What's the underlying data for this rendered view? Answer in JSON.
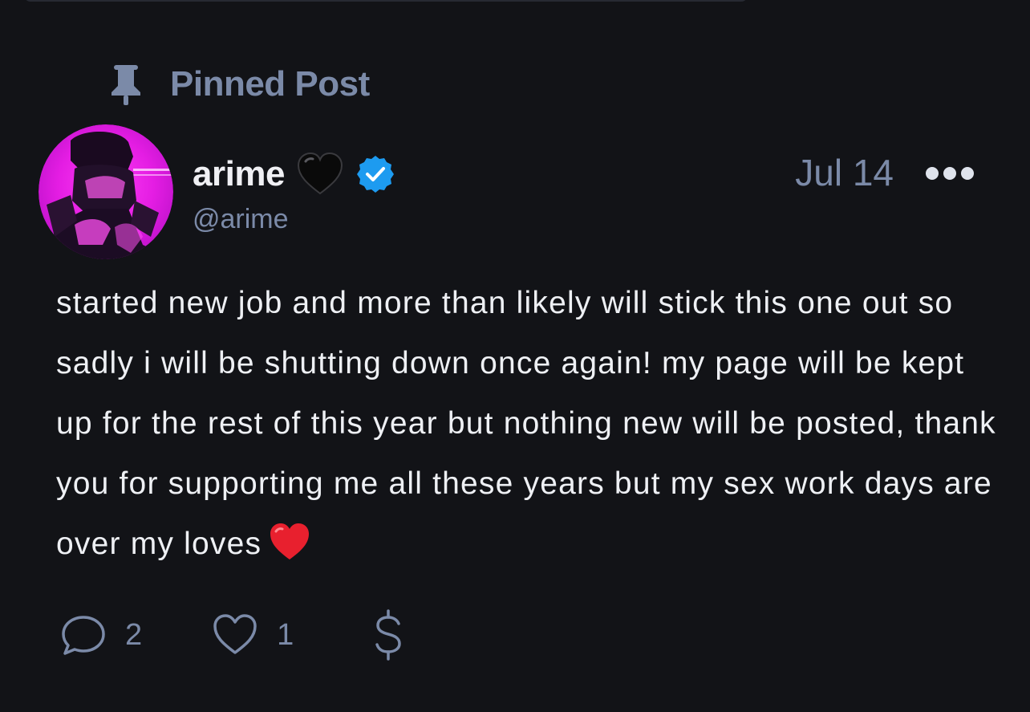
{
  "pinned": {
    "icon": "pin-icon",
    "label": "Pinned Post"
  },
  "author": {
    "display_name": "arime",
    "name_emoji": "black-heart-icon",
    "verified_icon": "verified-badge-icon",
    "handle": "@arime",
    "avatar": "avatar-photo"
  },
  "post": {
    "date": "Jul 14",
    "more_icon": "more-options-icon",
    "text": "started new job and more than likely will stick this one out so sadly i will be shutting down once again! my page will be kept up for the rest of this year but nothing new will be posted, thank you for supporting me all these years but my sex work days are over my loves",
    "text_emoji": "red-heart-icon"
  },
  "actions": {
    "comments": {
      "icon": "comment-icon",
      "count": "2"
    },
    "likes": {
      "icon": "heart-outline-icon",
      "count": "1"
    },
    "tip": {
      "icon": "dollar-icon"
    }
  },
  "colors": {
    "background": "#121317",
    "muted": "#7b8aa8",
    "text": "#eef0f4",
    "verified": "#1d9bf0",
    "red_heart": "#e8202e",
    "avatar_accent": "#e41de3"
  }
}
